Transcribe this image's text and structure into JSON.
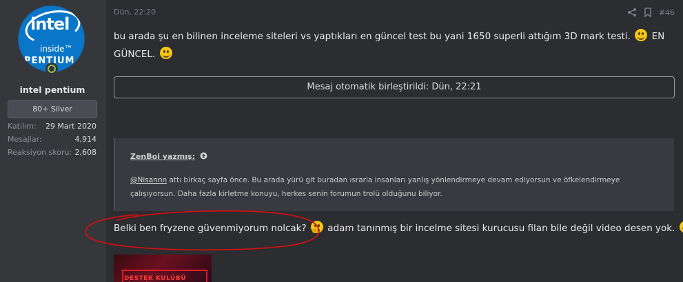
{
  "author": {
    "avatar_lines": [
      "intel",
      "inside™",
      "PENTIUM"
    ],
    "name": "intel pentium",
    "rank": "80+ Silver",
    "stats": [
      {
        "key": "Katılım:",
        "value": "29 Mart 2020"
      },
      {
        "key": "Mesajlar:",
        "value": "4,914"
      },
      {
        "key": "Reaksiyon skoru:",
        "value": "2,608"
      }
    ]
  },
  "post": {
    "date": "Dün, 22:20",
    "number": "#46",
    "icons": [
      "share-icon",
      "bookmark-icon"
    ],
    "text_part1": "bu arada şu en bilinen inceleme siteleri vs yaptıkları en güncel test bu yani 1650 superli attığım 3D mark testi.",
    "text_part2": "EN GÜNCEL.",
    "merge_notice": "Mesaj otomatik birleştirildi: Dün, 22:21",
    "quote": {
      "author": "ZenBoi yazmış:",
      "mention": "@Nisannn",
      "body": " attı birkaç sayfa önce. Bu arada yürü git buradan ısrarla insanları yanlış yönlendirmeye devam ediyorsun ve öfkelendirmeye çalışıyorsun. Daha fazla kirletme konuyu, herkes senin forumun trolü olduğunu biliyor."
    },
    "reply_part1": "Belki ben fryzene güvenmiyorum nolcak?",
    "reply_part2": "adam tanınmış bir incelme sitesi kurucusu filan bile değil video desen yok.",
    "attachment_label": "DESTEK KULÜBÜ LİVESİ"
  },
  "colors": {
    "background": "#2b2d31",
    "sidebar": "#35373b",
    "annotation": "#cc1111",
    "online": "#8bc34a"
  }
}
